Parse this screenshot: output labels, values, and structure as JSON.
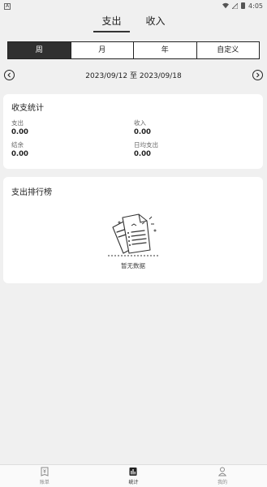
{
  "status_bar": {
    "app_indicator": "A",
    "time": "4:05"
  },
  "top_tabs": [
    {
      "label": "支出",
      "active": true
    },
    {
      "label": "收入",
      "active": false
    }
  ],
  "period_tabs": [
    {
      "label": "周",
      "active": true
    },
    {
      "label": "月",
      "active": false
    },
    {
      "label": "年",
      "active": false
    },
    {
      "label": "自定义",
      "active": false
    }
  ],
  "date_range": "2023/09/12 至 2023/09/18",
  "stats": {
    "title": "收支统计",
    "items": [
      {
        "label": "支出",
        "value": "0.00"
      },
      {
        "label": "收入",
        "value": "0.00"
      },
      {
        "label": "结余",
        "value": "0.00"
      },
      {
        "label": "日均支出",
        "value": "0.00"
      }
    ]
  },
  "ranking": {
    "title": "支出排行榜",
    "empty_text": "暂无数据"
  },
  "bottom_nav": [
    {
      "label": "账单",
      "icon": "receipt-icon",
      "active": false
    },
    {
      "label": "统计",
      "icon": "chart-icon",
      "active": true
    },
    {
      "label": "我的",
      "icon": "person-icon",
      "active": false
    }
  ],
  "colors": {
    "background": "#f0f0f0",
    "card": "#ffffff",
    "active_segment": "#303030",
    "text": "#222222"
  }
}
